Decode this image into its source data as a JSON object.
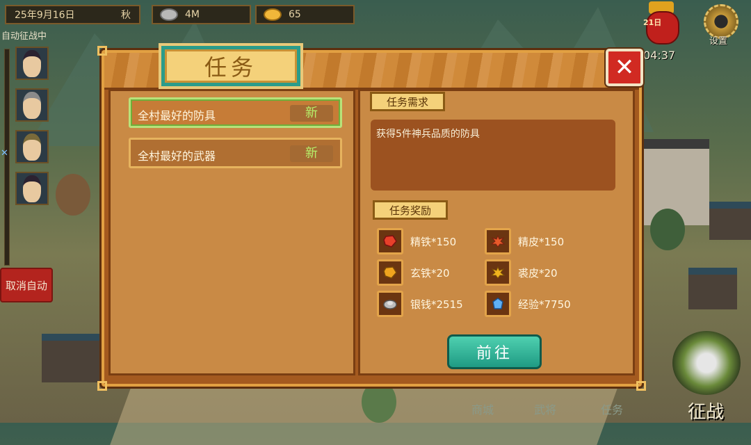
{
  "hud": {
    "date": "25年9月16日",
    "season": "秋",
    "silver": "4M",
    "gold": "65",
    "auto_battle_label": "自动征战中",
    "cancel_auto": "取消自动",
    "timer": "04:37",
    "settings": "设置",
    "event_badge": "21日"
  },
  "bottom_nav": {
    "shop": "商城",
    "generals": "武将",
    "tasks": "任务",
    "battle": "征战"
  },
  "dialog": {
    "title": "任务",
    "close": "✕",
    "tasks": [
      {
        "name": "全村最好的防具",
        "tag": "新",
        "selected": true
      },
      {
        "name": "全村最好的武器",
        "tag": "新",
        "selected": false
      }
    ],
    "requirement_header": "任务需求",
    "requirement_text": "获得5件神兵品质的防具",
    "reward_header": "任务奖励",
    "rewards": [
      {
        "icon": "red-ore-icon",
        "label": "精铁*150",
        "color": "#e8402a"
      },
      {
        "icon": "red-hide-icon",
        "label": "精皮*150",
        "color": "#e85a2a"
      },
      {
        "icon": "gold-ore-icon",
        "label": "玄铁*20",
        "color": "#f0a41e"
      },
      {
        "icon": "gold-hide-icon",
        "label": "裘皮*20",
        "color": "#f0b41e"
      },
      {
        "icon": "silver-coin-icon",
        "label": "银钱*2515",
        "color": "#bdbdbd"
      },
      {
        "icon": "exp-crystal-icon",
        "label": "经验*7750",
        "color": "#5fb0f5"
      }
    ],
    "go_button": "前往"
  }
}
